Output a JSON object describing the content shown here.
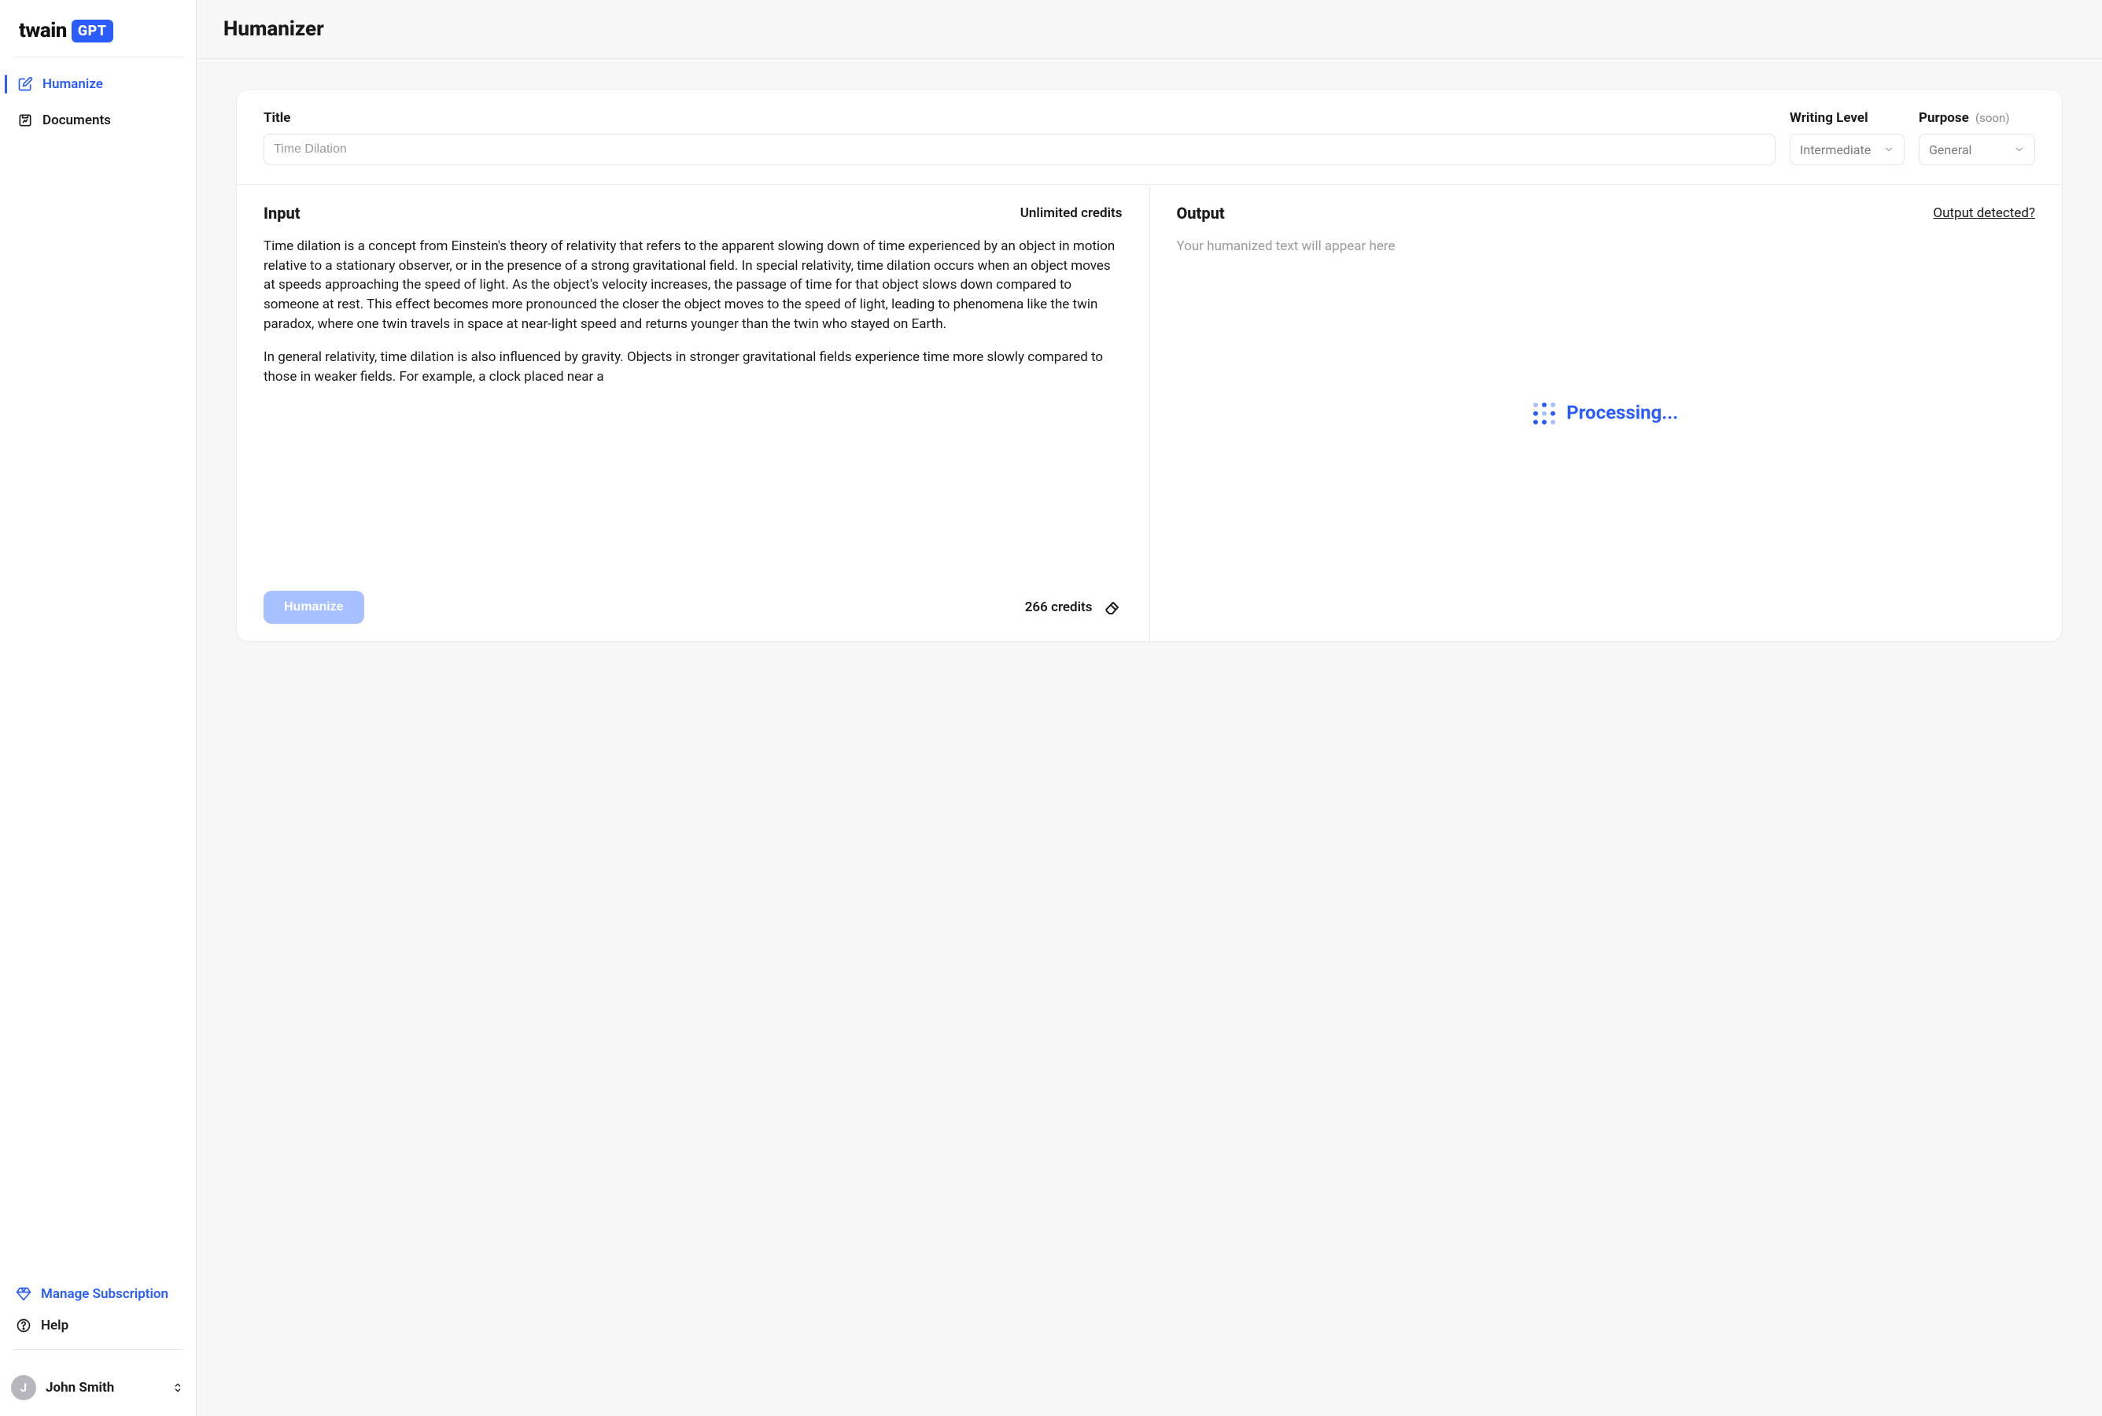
{
  "brand": {
    "name1": "twain",
    "name2": "GPT"
  },
  "sidebar": {
    "items": [
      {
        "label": "Humanize"
      },
      {
        "label": "Documents"
      }
    ],
    "bottom": [
      {
        "label": "Manage Subscription"
      },
      {
        "label": "Help"
      }
    ]
  },
  "user": {
    "initial": "J",
    "name": "John Smith"
  },
  "page": {
    "title": "Humanizer"
  },
  "header": {
    "title_label": "Title",
    "title_value": "Time Dilation",
    "writing_level_label": "Writing Level",
    "writing_level_value": "Intermediate",
    "purpose_label": "Purpose",
    "purpose_soon": "(soon)",
    "purpose_value": "General"
  },
  "input": {
    "heading": "Input",
    "credits_label": "Unlimited credits",
    "paragraph1": "Time dilation is a concept from Einstein's theory of relativity that refers to the apparent slowing down of time experienced by an object in motion relative to a stationary observer, or in the presence of a strong gravitational field. In special relativity, time dilation occurs when an object moves at speeds approaching the speed of light. As the object's velocity increases, the passage of time for that object slows down compared to someone at rest. This effect becomes more pronounced the closer the object moves to the speed of light, leading to phenomena like the twin paradox, where one twin travels in space at near-light speed and returns younger than the twin who stayed on Earth.",
    "paragraph2": "In general relativity, time dilation is also influenced by gravity. Objects in stronger gravitational fields experience time more slowly compared to those in weaker fields. For example, a clock placed near a",
    "humanize_button": "Humanize",
    "credit_count": "266 credits"
  },
  "output": {
    "heading": "Output",
    "detected_link": "Output detected?",
    "placeholder": "Your humanized text will appear here",
    "processing": "Processing..."
  }
}
